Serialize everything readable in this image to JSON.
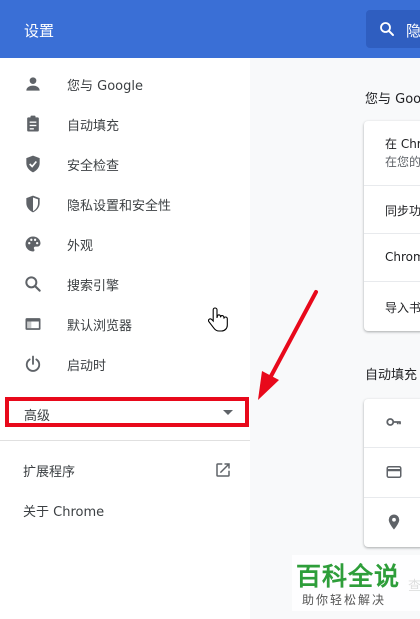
{
  "header": {
    "title": "设置",
    "search_text": "隐"
  },
  "sidebar": {
    "items": [
      {
        "label": "您与 Google",
        "icon": "person-icon"
      },
      {
        "label": "自动填充",
        "icon": "clipboard-icon"
      },
      {
        "label": "安全检查",
        "icon": "shield-check-icon"
      },
      {
        "label": "隐私设置和安全性",
        "icon": "privacy-shield-icon"
      },
      {
        "label": "外观",
        "icon": "palette-icon"
      },
      {
        "label": "搜索引擎",
        "icon": "search-icon"
      },
      {
        "label": "默认浏览器",
        "icon": "browser-window-icon"
      },
      {
        "label": "启动时",
        "icon": "power-icon"
      }
    ],
    "advanced": "高级",
    "extensions": "扩展程序",
    "about": "关于 Chrome"
  },
  "main": {
    "section1_title": "您与 Goo",
    "section1_rows": [
      "在 Chr",
      "在您的",
      "同步功",
      "Chrom",
      "导入书"
    ],
    "section2_title": "自动填充",
    "section3_partial": "查"
  },
  "watermark": {
    "main": "百科全说",
    "sub": "助你轻松解决"
  },
  "colors": {
    "header": "#3a6fd6",
    "highlight": "#e8091b",
    "watermark_green": "#2e9e3a"
  }
}
